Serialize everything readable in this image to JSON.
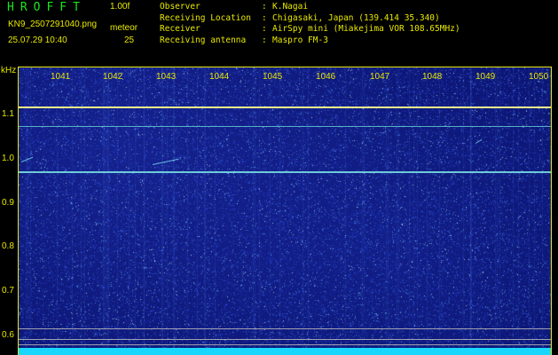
{
  "header": {
    "app_title": "HROFFT",
    "version": "1.00f",
    "filename": "KN9_2507291040.png",
    "timestamp": "25.07.29 10:40",
    "count_label": "meteor",
    "count_value": "25"
  },
  "info": [
    {
      "key": "Observer",
      "sep": ":",
      "value": "K.Nagai"
    },
    {
      "key": "Receiving Location",
      "sep": ":",
      "value": "Chigasaki, Japan (139.414 35.340)"
    },
    {
      "key": "Receiver",
      "sep": ":",
      "value": "AirSpy mini (Miakejima VOR 108.65MHz)"
    },
    {
      "key": "Receiving antenna",
      "sep": ":",
      "value": "Maspro FM-3"
    }
  ],
  "axis": {
    "unit": "kHz",
    "time_ticks": [
      "1041",
      "1042",
      "1043",
      "1044",
      "1045",
      "1046",
      "1047",
      "1048",
      "1049",
      "1050"
    ],
    "freq_ticks": [
      "1.1",
      "1.0",
      "0.9",
      "0.8",
      "0.7",
      "0.6"
    ]
  },
  "colors": {
    "background": "#000000",
    "text": "#e8e800",
    "title": "#18e818",
    "plot_bg": "#0b1470",
    "signal": "#f0f08a",
    "signal_secondary": "#66d6d6",
    "baseline": "#19d6ff"
  }
}
